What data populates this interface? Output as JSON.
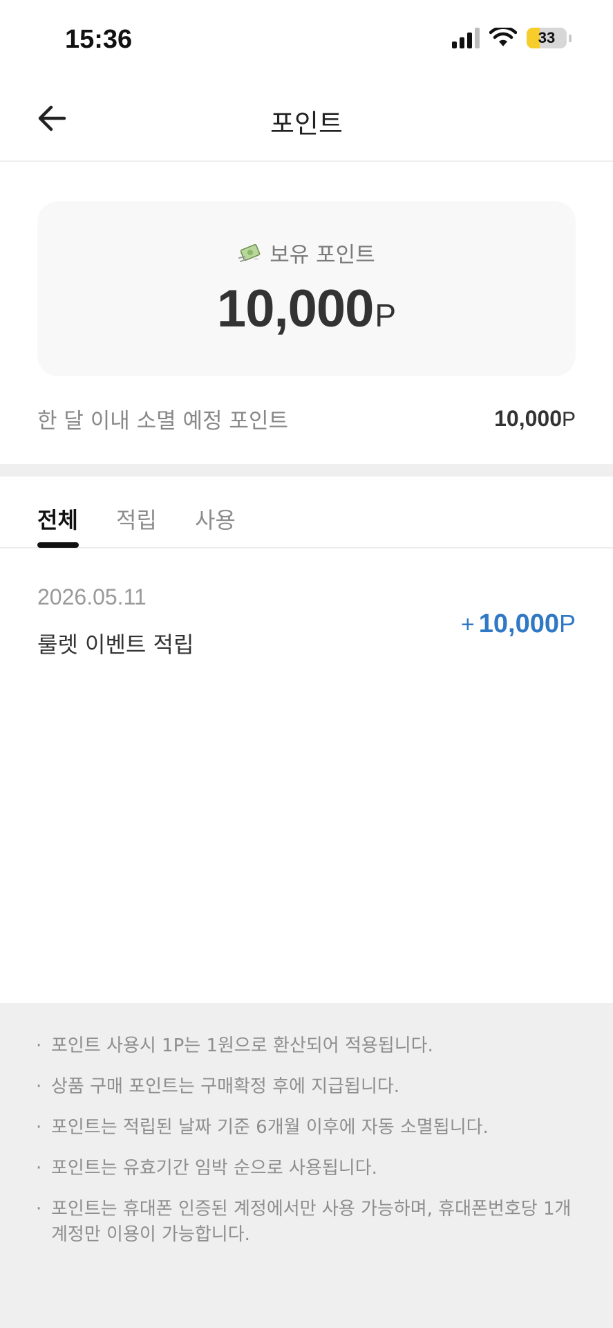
{
  "status_bar": {
    "time": "15:36",
    "battery": "33",
    "battery_level": 0.33
  },
  "header": {
    "title": "포인트"
  },
  "points_card": {
    "label": "보유 포인트",
    "value": "10,000",
    "unit": "P"
  },
  "expiring": {
    "label": "한 달 이내 소멸 예정 포인트",
    "value": "10,000",
    "unit": "P"
  },
  "tabs": [
    {
      "label": "전체",
      "active": true
    },
    {
      "label": "적립",
      "active": false
    },
    {
      "label": "사용",
      "active": false
    }
  ],
  "history": [
    {
      "date": "2026.05.11",
      "description": "룰렛 이벤트 적립",
      "sign": "+",
      "amount": "10,000",
      "unit": "P"
    }
  ],
  "notices": [
    "포인트 사용시 1P는 1원으로 환산되어 적용됩니다.",
    "상품 구매 포인트는 구매확정 후에 지급됩니다.",
    "포인트는 적립된 날짜 기준 6개월 이후에 자동 소멸됩니다.",
    "포인트는 유효기간 임박 순으로 사용됩니다.",
    "포인트는 휴대폰 인증된 계정에서만 사용 가능하며, 휴대폰번호당 1개 계정만 이용이 가능합니다."
  ],
  "notice_bullet": "·",
  "colors": {
    "accent_blue": "#2f78c4",
    "battery_yellow": "#f7cd2c",
    "divider_gray": "#efefef"
  }
}
